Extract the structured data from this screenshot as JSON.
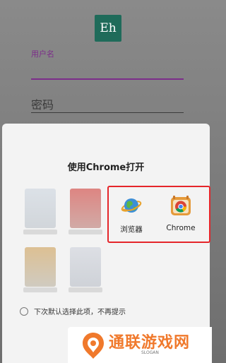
{
  "login": {
    "logo_text": "Eh",
    "username_label": "用户名",
    "password_placeholder": "密码"
  },
  "chooser": {
    "title": "使用Chrome打开",
    "apps": [
      {
        "label": "浏览器",
        "icon": "globe-browser-icon"
      },
      {
        "label": "Chrome",
        "icon": "chrome-icon"
      }
    ],
    "remember_label": "下次默认选择此项，不再提示",
    "highlight_color": "#e5252a"
  },
  "watermark": {
    "text": "通联游戏网",
    "slogan": "SLOGAN"
  }
}
